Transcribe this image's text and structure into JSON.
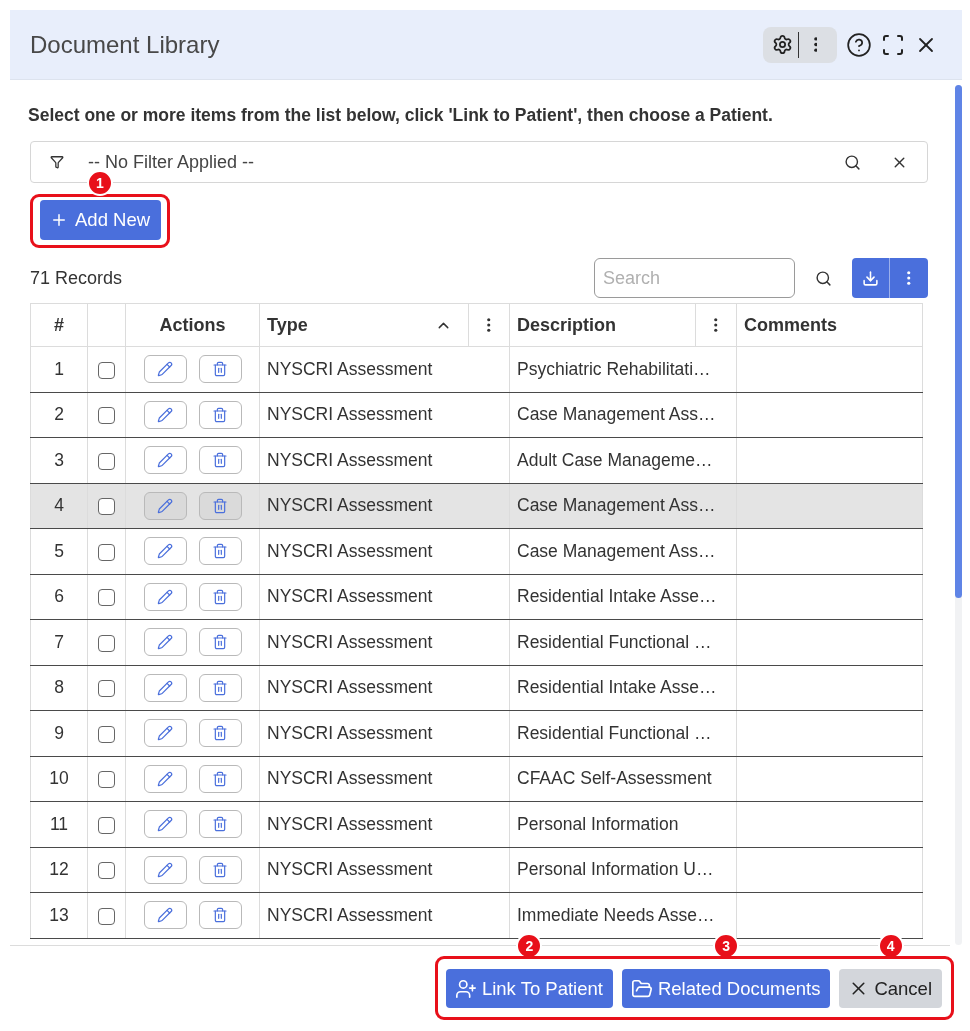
{
  "window": {
    "title": "Document Library"
  },
  "instructions": "Select one or more items from the list below, click 'Link to Patient', then choose a Patient.",
  "filter": {
    "value": "-- No Filter Applied --"
  },
  "add_button": {
    "label": "Add New",
    "framed": true,
    "callout": "1"
  },
  "records": {
    "count": "71 Records"
  },
  "search": {
    "placeholder": "Search"
  },
  "table": {
    "columns": [
      {
        "kind": "number",
        "label": "#"
      },
      {
        "kind": "select"
      },
      {
        "kind": "actions",
        "label": "Actions"
      },
      {
        "kind": "text",
        "label": "Type",
        "sorted_ascending": true,
        "menu": true
      },
      {
        "kind": "text",
        "label": "Description",
        "menu": true
      },
      {
        "kind": "text",
        "label": "Comments"
      }
    ],
    "rows": [
      {
        "number": "1",
        "checked": false,
        "hovered": false,
        "cells": [
          "NYSCRI Assessment",
          "Psychiatric Rehabilitati…"
        ]
      },
      {
        "number": "2",
        "checked": false,
        "hovered": false,
        "cells": [
          "NYSCRI Assessment",
          "Case Management Ass…"
        ]
      },
      {
        "number": "3",
        "checked": false,
        "hovered": false,
        "cells": [
          "NYSCRI Assessment",
          "Adult Case Manageme…"
        ]
      },
      {
        "number": "4",
        "checked": false,
        "hovered": true,
        "cells": [
          "NYSCRI Assessment",
          "Case Management Ass…"
        ]
      },
      {
        "number": "5",
        "checked": false,
        "hovered": false,
        "cells": [
          "NYSCRI Assessment",
          "Case Management Ass…"
        ]
      },
      {
        "number": "6",
        "checked": false,
        "hovered": false,
        "cells": [
          "NYSCRI Assessment",
          "Residential Intake Asse…"
        ]
      },
      {
        "number": "7",
        "checked": false,
        "hovered": false,
        "cells": [
          "NYSCRI Assessment",
          "Residential Functional …"
        ]
      },
      {
        "number": "8",
        "checked": false,
        "hovered": false,
        "cells": [
          "NYSCRI Assessment",
          "Residential Intake Asse…"
        ]
      },
      {
        "number": "9",
        "checked": false,
        "hovered": false,
        "cells": [
          "NYSCRI Assessment",
          "Residential Functional …"
        ]
      },
      {
        "number": "10",
        "checked": false,
        "hovered": false,
        "cells": [
          "NYSCRI Assessment",
          "CFAAC Self-Assessment"
        ]
      },
      {
        "number": "11",
        "checked": false,
        "hovered": false,
        "cells": [
          "NYSCRI Assessment",
          "Personal Information"
        ]
      },
      {
        "number": "12",
        "checked": false,
        "hovered": false,
        "cells": [
          "NYSCRI Assessment",
          "Personal Information U…"
        ]
      },
      {
        "number": "13",
        "checked": false,
        "hovered": false,
        "cells": [
          "NYSCRI Assessment",
          "Immediate Needs Asse…"
        ]
      }
    ]
  },
  "footer": {
    "framed": true,
    "buttons": [
      {
        "kind": "link",
        "label": "Link To Patient",
        "callout": "2"
      },
      {
        "kind": "folder",
        "label": "Related Documents",
        "callout": "3"
      },
      {
        "kind": "cancel",
        "label": "Cancel",
        "callout": "4"
      }
    ]
  }
}
